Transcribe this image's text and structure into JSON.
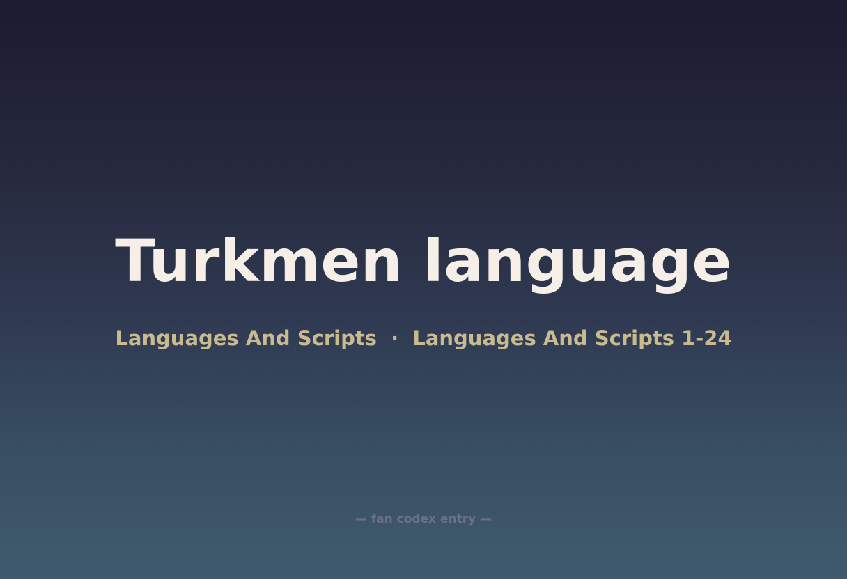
{
  "entry": {
    "title": "Turkmen language",
    "subtitle": "Languages And Scripts  ·  Languages And Scripts 1-24",
    "footer": "— fan codex entry —"
  }
}
